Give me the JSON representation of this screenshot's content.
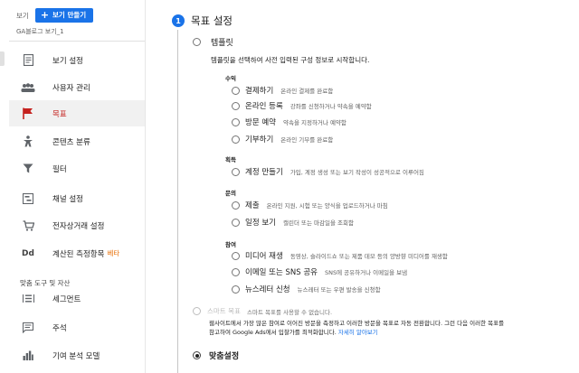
{
  "sidebar": {
    "view_label": "보기",
    "create_view_button": "보기 만들기",
    "view_name": "GA블로그 보기_1",
    "items": [
      {
        "label": "보기 설정",
        "icon": "document-icon"
      },
      {
        "label": "사용자 관리",
        "icon": "people-icon"
      },
      {
        "label": "목표",
        "icon": "flag-icon",
        "active": true
      },
      {
        "label": "콘텐츠 분류",
        "icon": "figure-icon"
      },
      {
        "label": "필터",
        "icon": "filter-icon"
      },
      {
        "label": "채널 설정",
        "icon": "channel-icon"
      },
      {
        "label": "전자상거래 설정",
        "icon": "cart-icon"
      },
      {
        "label": "계산된 측정항목",
        "badge": "베타",
        "icon": "dd-icon"
      }
    ],
    "section_title": "맞춤 도구 및 자산",
    "tools": [
      {
        "label": "세그먼트",
        "icon": "segment-icon"
      },
      {
        "label": "주석",
        "icon": "comment-icon"
      },
      {
        "label": "기여 분석 모델",
        "icon": "bar-chart-icon"
      }
    ]
  },
  "main": {
    "step_number": "1",
    "step_title": "목표 설정",
    "template": {
      "label": "템플릿",
      "description": "템플릿을 선택하여 사전 입력된 구성 정보로 시작합니다."
    },
    "categories": [
      {
        "title": "수익",
        "options": [
          {
            "label": "결제하기",
            "desc": "온라인 결제를 완료함"
          },
          {
            "label": "온라인 등록",
            "desc": "강좌를 신청하거나 약속을 예약함"
          },
          {
            "label": "방문 예약",
            "desc": "약속을 지정하거나 예약함"
          },
          {
            "label": "기부하기",
            "desc": "온라인 기부를 완료함"
          }
        ]
      },
      {
        "title": "획득",
        "options": [
          {
            "label": "계정 만들기",
            "desc": "가입, 계정 생성 또는 보기 작성이 성공적으로 이루어짐"
          }
        ]
      },
      {
        "title": "문의",
        "options": [
          {
            "label": "제출",
            "desc": "온라인 지원, 시험 또는 양식을 업로드하거나 마침"
          },
          {
            "label": "일정 보기",
            "desc": "캘린더 또는 마감일을 조회함"
          }
        ]
      },
      {
        "title": "참여",
        "options": [
          {
            "label": "미디어 재생",
            "desc": "동영상, 슬라이드쇼 또는 제품 데모 등의 양방향 미디어를 재생함"
          },
          {
            "label": "이메일 또는 SNS 공유",
            "desc": "SNS에 공유하거나 이메일을 보냄"
          },
          {
            "label": "뉴스레터 신청",
            "desc": "뉴스레터 또는 우편 발송을 신청함"
          }
        ]
      }
    ],
    "smart_goal": {
      "label": "스마트 목표",
      "sub": "스마트 목표를 사용할 수 없습니다.",
      "desc_line1": "웹사이트에서 가장 많은 참여로 이어진 방문을 측정하고 이러한 방문을 목표로 자동 전환합니다. 그런 다음 이러한 목표를",
      "desc_line2_prefix": "참고하여 Google Ads에서 입찰가를 최적화합니다. ",
      "desc_link": "자세히 알아보기"
    },
    "custom": {
      "label": "맞춤설정"
    }
  }
}
